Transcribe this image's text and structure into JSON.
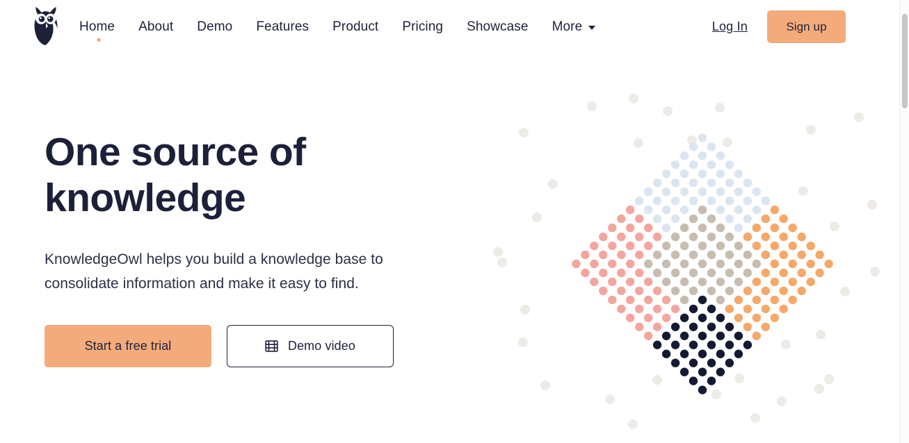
{
  "brand": {
    "logo_icon": "owl-logo-icon",
    "logo_color": "#1c2038"
  },
  "nav": {
    "items": [
      {
        "label": "Home",
        "active": true,
        "has_caret": false
      },
      {
        "label": "About",
        "active": false,
        "has_caret": false
      },
      {
        "label": "Demo",
        "active": false,
        "has_caret": false
      },
      {
        "label": "Features",
        "active": false,
        "has_caret": false
      },
      {
        "label": "Product",
        "active": false,
        "has_caret": false
      },
      {
        "label": "Pricing",
        "active": false,
        "has_caret": false
      },
      {
        "label": "Showcase",
        "active": false,
        "has_caret": false
      },
      {
        "label": "More",
        "active": false,
        "has_caret": true
      }
    ],
    "active_dot_color": "#f2a375"
  },
  "header_actions": {
    "login_label": "Log In",
    "signup_label": "Sign up",
    "signup_bg": "#f4ab7b"
  },
  "hero": {
    "title": "One source of\nknowledge",
    "subtitle": "KnowledgeOwl helps you build a knowledge base to\nconsolidate information and make it easy to find.",
    "primary_cta": "Start a free trial",
    "secondary_cta": "Demo video",
    "secondary_cta_icon": "film-strip-icon",
    "title_color": "#1c2038",
    "primary_cta_bg": "#f4ab7b"
  },
  "decoration": {
    "name": "diamond-dot-grid",
    "colors": {
      "top_light_blue": "#dbe5f1",
      "left_pink": "#f3a6a0",
      "right_orange": "#f5a868",
      "center_beige": "#c6bdb0",
      "bottom_navy": "#151a33",
      "scatter_grey": "#eeebe7"
    },
    "quadrants": [
      "top: light blue",
      "left: pink",
      "right: orange",
      "bottom: navy",
      "center: beige"
    ]
  }
}
